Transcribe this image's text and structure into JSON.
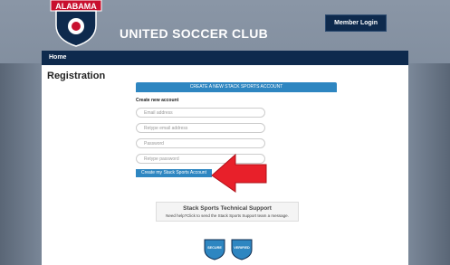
{
  "header": {
    "logo_text": "ALABAMA",
    "title": "UNITED SOCCER CLUB",
    "login_label": "Member Login"
  },
  "nav": {
    "home_label": "Home"
  },
  "registration": {
    "title": "Registration",
    "banner": "CREATE A NEW STACK SPORTS ACCOUNT",
    "create_label": "Create new account",
    "fields": {
      "email_placeholder": "Email address",
      "retype_email_placeholder": "Retype email address",
      "password_placeholder": "Password",
      "retype_password_placeholder": "Retype password"
    },
    "create_button": "Create my Stack Sports Account"
  },
  "support": {
    "title": "Stack Sports Technical Support",
    "text": "Need help?Click to send the Stack Sports Support team a message."
  },
  "badges": [
    "SECURE",
    "VERIFIED"
  ],
  "colors": {
    "navy": "#0e2a4d",
    "accent_blue": "#2e86c1",
    "arrow_red": "#e8202a"
  },
  "icons": {
    "logo": "alabama-shield-logo",
    "arrow": "red-arrow-icon",
    "badges": "shield-badge-icon"
  }
}
